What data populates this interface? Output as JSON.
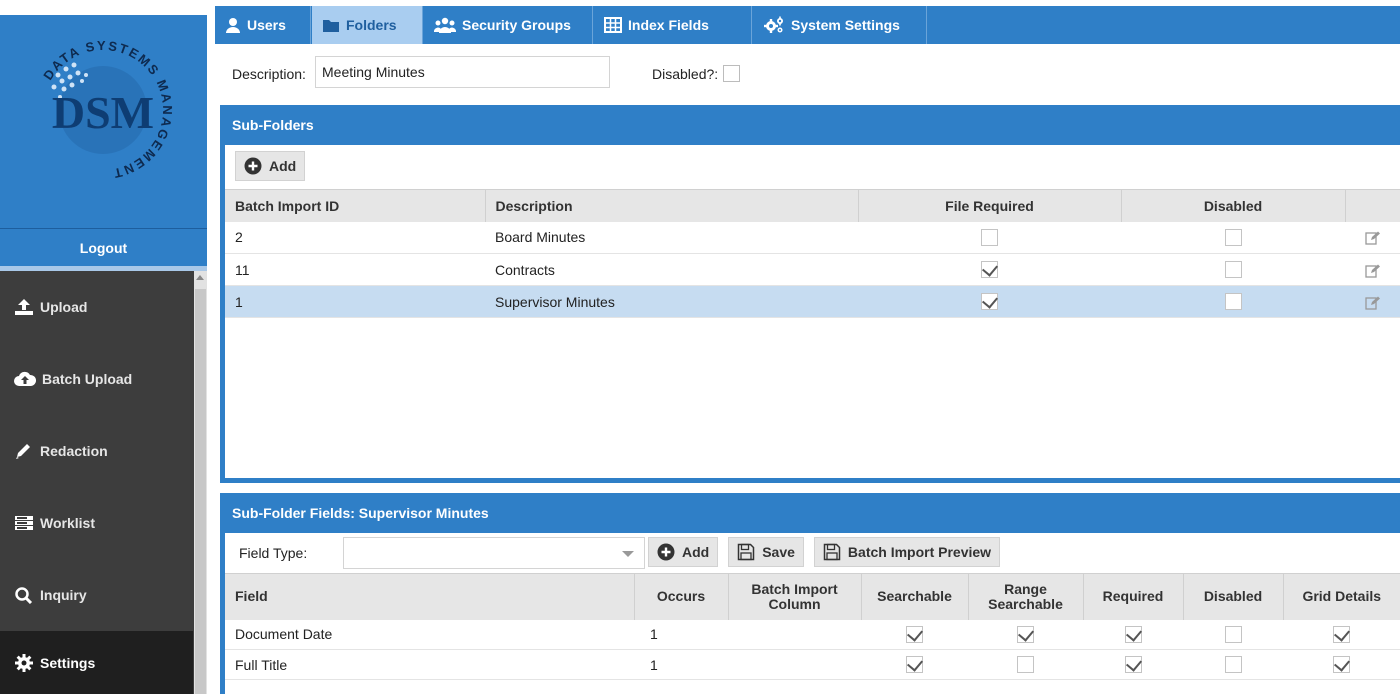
{
  "brand": {
    "logo_letters": "DSM",
    "logo_ring_text": "DATA SYSTEMS MANAGEMENT"
  },
  "sidebar": {
    "logout_label": "Logout",
    "items": [
      {
        "label": "Upload",
        "icon": "upload-icon"
      },
      {
        "label": "Batch Upload",
        "icon": "cloud-upload-icon"
      },
      {
        "label": "Redaction",
        "icon": "pencil-icon"
      },
      {
        "label": "Worklist",
        "icon": "worklist-icon"
      },
      {
        "label": "Inquiry",
        "icon": "search-icon"
      },
      {
        "label": "Settings",
        "icon": "gear-icon"
      }
    ],
    "active": "Settings"
  },
  "tabs": [
    {
      "label": "Users",
      "icon": "user-icon"
    },
    {
      "label": "Folders",
      "icon": "folder-icon"
    },
    {
      "label": "Security Groups",
      "icon": "group-icon"
    },
    {
      "label": "Index Fields",
      "icon": "table-icon"
    },
    {
      "label": "System Settings",
      "icon": "gears-icon"
    }
  ],
  "active_tab": "Folders",
  "folder": {
    "description_label": "Description:",
    "description_value": "Meeting Minutes",
    "disabled_label": "Disabled?:",
    "disabled": false
  },
  "subfolders": {
    "title": "Sub-Folders",
    "add_label": "Add",
    "columns": [
      "Batch Import ID",
      "Description",
      "File Required",
      "Disabled"
    ],
    "rows": [
      {
        "id": "2",
        "description": "Board Minutes",
        "file_required": false,
        "disabled": false
      },
      {
        "id": "11",
        "description": "Contracts",
        "file_required": true,
        "disabled": false
      },
      {
        "id": "1",
        "description": "Supervisor Minutes",
        "file_required": true,
        "disabled": false,
        "selected": true
      }
    ]
  },
  "subfolder_fields": {
    "title": "Sub-Folder Fields: Supervisor Minutes",
    "field_type_label": "Field Type:",
    "field_type_value": "",
    "add_label": "Add",
    "save_label": "Save",
    "batch_preview_label": "Batch Import Preview",
    "columns": [
      "Field",
      "Occurs",
      "Batch Import Column",
      "Searchable",
      "Range Searchable",
      "Required",
      "Disabled",
      "Grid Details"
    ],
    "rows": [
      {
        "field": "Document Date",
        "occurs": "1",
        "batch_column": "",
        "searchable": true,
        "range_searchable": true,
        "required": true,
        "disabled": false,
        "grid_details": true
      },
      {
        "field": "Full Title",
        "occurs": "1",
        "batch_column": "",
        "searchable": true,
        "range_searchable": false,
        "required": true,
        "disabled": false,
        "grid_details": true
      }
    ]
  },
  "colors": {
    "primary": "#2f7fc7",
    "sidebar": "#3d3d3d",
    "active_tab": "#a9cdf0",
    "selected_row": "#c6dcf1"
  }
}
